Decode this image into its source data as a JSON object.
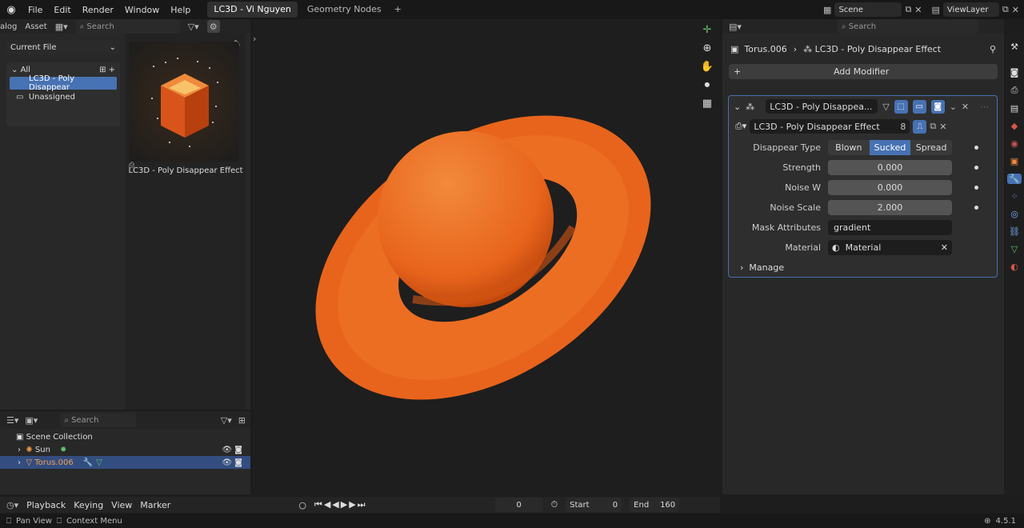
{
  "topbar": {
    "menu": [
      "File",
      "Edit",
      "Render",
      "Window",
      "Help"
    ],
    "tabs": [
      "LC3D - Vi Nguyen",
      "Geometry Nodes"
    ],
    "add_tab": "+",
    "scene_label": "Scene",
    "viewlayer_label": "ViewLayer"
  },
  "asset_browser": {
    "header_labels": [
      "alog",
      "Asset"
    ],
    "search_placeholder": "Search",
    "library": "Current File",
    "tree_all": "All",
    "tree_items": [
      "LC3D - Poly Disappear",
      "Unassigned"
    ],
    "asset_name": "LC3D - Poly Disappear Effect"
  },
  "outliner": {
    "search_placeholder": "Search",
    "root": "Scene Collection",
    "items": [
      "Sun",
      "Torus.006"
    ]
  },
  "timeline": {
    "menu": [
      "Playback",
      "Keying",
      "View",
      "Marker"
    ],
    "frame": "0",
    "start_label": "Start",
    "start": "0",
    "end_label": "End",
    "end": "160"
  },
  "properties": {
    "search_placeholder": "Search",
    "breadcrumb_object": "Torus.006",
    "breadcrumb_modifier": "LC3D - Poly Disappear Effect",
    "add_modifier": "Add Modifier",
    "modifier_name": "LC3D - Poly Disappea...",
    "node_group": "LC3D - Poly Disappear Effect",
    "users": "8",
    "labels": {
      "disappear_type": "Disappear Type",
      "strength": "Strength",
      "noise_w": "Noise W",
      "noise_scale": "Noise Scale",
      "mask": "Mask Attributes",
      "material": "Material"
    },
    "disappear_options": [
      "Blown",
      "Sucked",
      "Spread"
    ],
    "selected_option": "Sucked",
    "strength": "0.000",
    "noise_w": "0.000",
    "noise_scale": "2.000",
    "mask_attr": "gradient",
    "material": "Material",
    "manage": "Manage"
  },
  "statusbar": {
    "pan": "Pan View",
    "context": "Context Menu",
    "version": "4.5.1"
  },
  "colors": {
    "accent": "#4772b3",
    "torus": "#e8641c",
    "panel": "#282828"
  }
}
